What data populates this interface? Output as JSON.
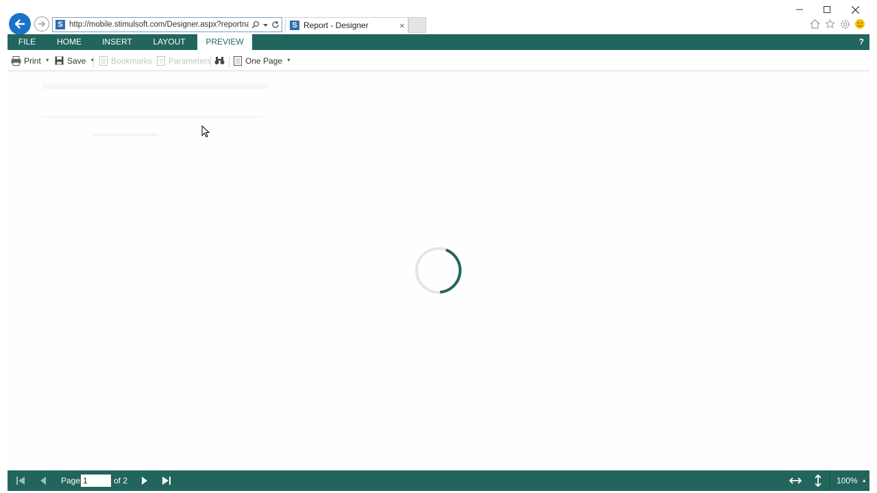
{
  "browser": {
    "url": "http://mobile.stimulsoft.com/Designer.aspx?reportnam",
    "tab_title": "Report - Designer",
    "tab_close": "×"
  },
  "ribbon": {
    "tabs": [
      {
        "label": "FILE"
      },
      {
        "label": "HOME"
      },
      {
        "label": "INSERT"
      },
      {
        "label": "LAYOUT"
      },
      {
        "label": "PREVIEW",
        "active": true
      }
    ],
    "help": "?"
  },
  "toolbar": {
    "print": "Print",
    "save": "Save",
    "bookmarks": "Bookmarks",
    "parameters": "Parameters",
    "view_mode": "One Page"
  },
  "statusbar": {
    "page_label": "Page",
    "page_value": "1",
    "page_of": "of 2",
    "zoom": "100%"
  },
  "colors": {
    "accent": "#22655c",
    "back_button": "#1a73c8"
  },
  "state": {
    "loading": true
  }
}
